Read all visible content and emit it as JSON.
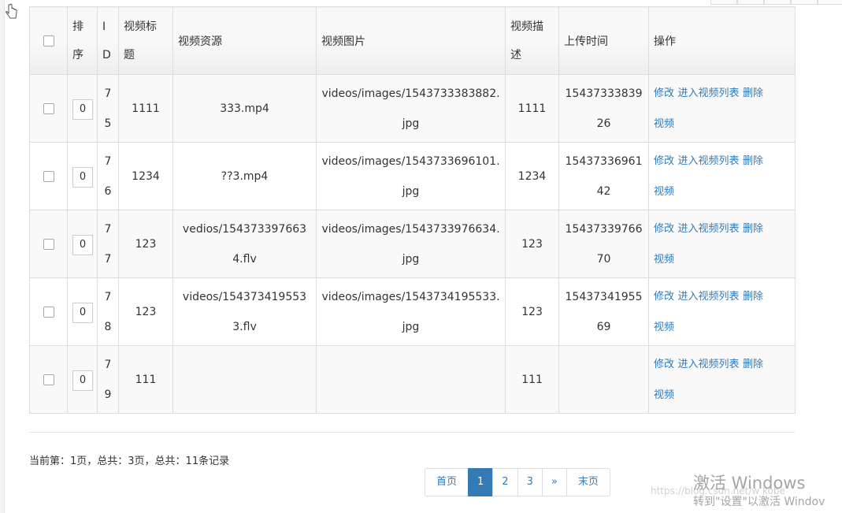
{
  "table": {
    "headers": {
      "sort": [
        "排",
        "序"
      ],
      "id": [
        "I",
        "D"
      ],
      "title": [
        "视频标",
        "题"
      ],
      "source": "视频资源",
      "image": "视频图片",
      "desc": [
        "视频描",
        "述"
      ],
      "upload_time": "上传时间",
      "actions": "操作"
    },
    "rows": [
      {
        "sort": "0",
        "id": [
          "7",
          "5"
        ],
        "title": "1111",
        "source": "333.mp4",
        "image": "videos/images/1543733383882.jpg",
        "desc": "1111",
        "time": "1543733383926"
      },
      {
        "sort": "0",
        "id": [
          "7",
          "6"
        ],
        "title": "1234",
        "source": "??3.mp4",
        "image": "videos/images/1543733696101.jpg",
        "desc": "1234",
        "time": "1543733696142"
      },
      {
        "sort": "0",
        "id": [
          "7",
          "7"
        ],
        "title": "123",
        "source": "vedios/1543733976634.flv",
        "image": "videos/images/1543733976634.jpg",
        "desc": "123",
        "time": "1543733976670"
      },
      {
        "sort": "0",
        "id": [
          "7",
          "8"
        ],
        "title": "123",
        "source": "videos/1543734195533.flv",
        "image": "videos/images/1543734195533.jpg",
        "desc": "123",
        "time": "1543734195569"
      },
      {
        "sort": "0",
        "id": [
          "7",
          "9"
        ],
        "title": "111",
        "source": "",
        "image": "",
        "desc": "111",
        "time": ""
      }
    ],
    "actions": {
      "edit": "修改",
      "enter_list": "进入视频列表",
      "delete": "删除",
      "delete_tail": "视频"
    }
  },
  "page_info": "当前第：1页，总共：3页，总共：11条记录",
  "pager": {
    "first": "首页",
    "pages": [
      "1",
      "2",
      "3"
    ],
    "next": "»",
    "last": "末页",
    "current": "1"
  },
  "watermark": {
    "title": "激活 Windows",
    "subtitle": "转到\"设置\"以激活 Windov",
    "url": "https://blog.csdn.net/w  kobe"
  },
  "colors": {
    "link": "#337ab7",
    "border": "#dddddd",
    "stripe": "#f9f9f9"
  }
}
